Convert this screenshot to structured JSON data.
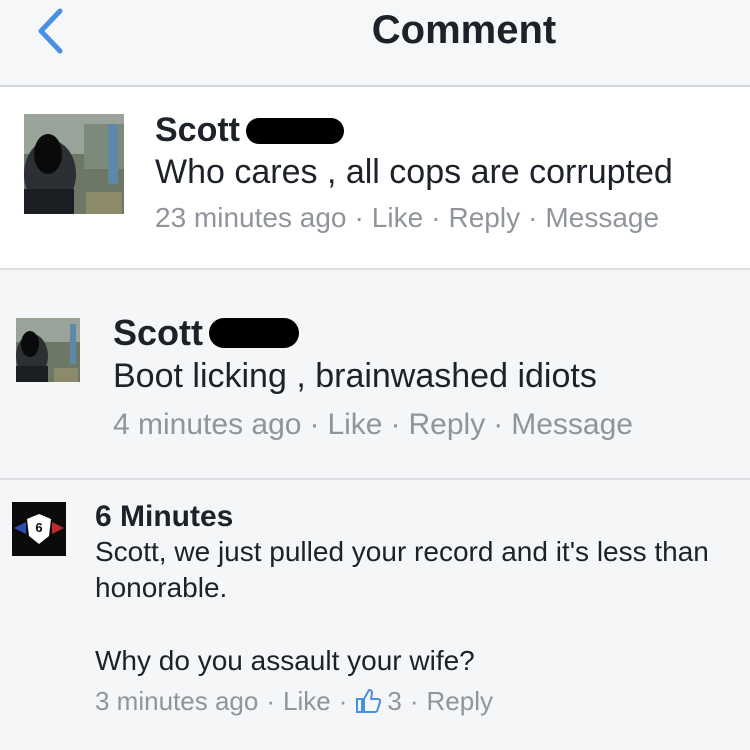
{
  "header": {
    "title": "Comment"
  },
  "comments": [
    {
      "author": "Scott",
      "text": "Who cares , all cops are corrupted",
      "time": "23 minutes ago",
      "like": "Like",
      "reply": "Reply",
      "message": "Message"
    },
    {
      "author": "Scott",
      "text": "Boot licking , brainwashed idiots",
      "time": "4 minutes ago",
      "like": "Like",
      "reply": "Reply",
      "message": "Message"
    },
    {
      "author": "6 Minutes",
      "text_line1": "Scott, we just pulled your record and it's less than honorable.",
      "text_line2": "Why do you assault your wife?",
      "time": "3 minutes ago",
      "like": "Like",
      "like_count": "3",
      "reply": "Reply",
      "avatar_badge": "6"
    }
  ],
  "colors": {
    "accent": "#4a90e2",
    "meta_gray": "#90949c",
    "background": "#f5f6f7"
  }
}
